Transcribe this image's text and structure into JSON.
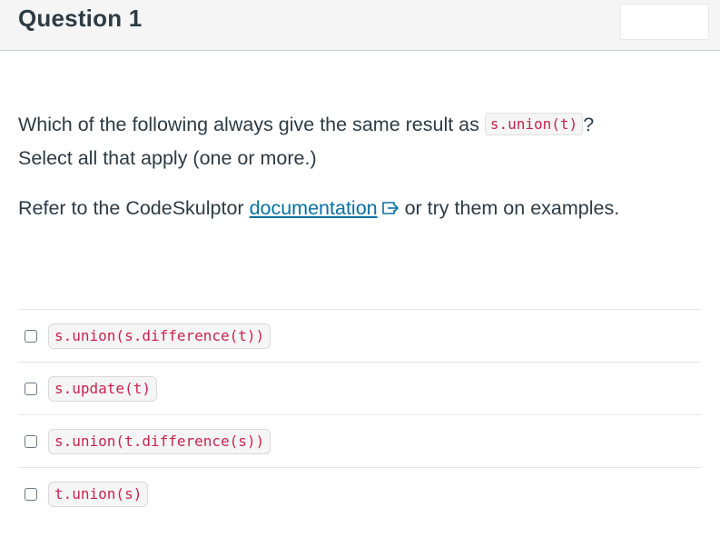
{
  "header": {
    "title": "Question 1"
  },
  "question": {
    "line1_prefix": "Which of the following always give the same result as ",
    "line1_code": "s.union(t)",
    "line1_suffix": "?",
    "line2": "Select all that apply (one or more.)",
    "refer_prefix": "Refer to the CodeSkulptor ",
    "refer_link": "documentation",
    "refer_suffix": " or try them on examples."
  },
  "answers": [
    {
      "code": "s.union(s.difference(t))"
    },
    {
      "code": "s.update(t)"
    },
    {
      "code": "s.union(t.difference(s))"
    },
    {
      "code": "t.union(s)"
    }
  ],
  "colors": {
    "code_text": "#c7254e",
    "link": "#0770a3",
    "header_bg": "#f5f5f5"
  },
  "icons": {
    "external_link": "external-link-icon"
  }
}
